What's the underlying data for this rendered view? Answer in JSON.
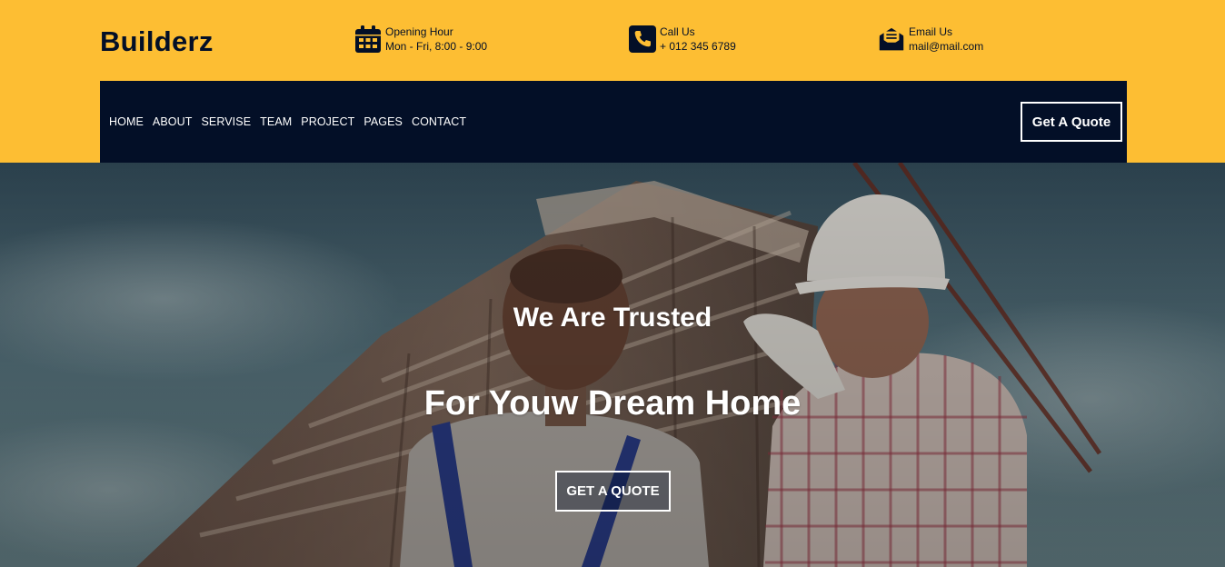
{
  "brand": {
    "name": "Builderz"
  },
  "header_info": {
    "hours": {
      "icon": "calendar-icon",
      "title": "Opening Hour",
      "value": "Mon - Fri, 8:00 - 9:00"
    },
    "call": {
      "icon": "phone-icon",
      "title": "Call Us",
      "value": "+ 012 345 6789"
    },
    "email": {
      "icon": "envelope-icon",
      "title": "Email Us",
      "value": "mail@mail.com"
    }
  },
  "nav": {
    "items": [
      "HOME",
      "ABOUT",
      "SERVISE",
      "TEAM",
      "PROJECT",
      "PAGES",
      "CONTACT"
    ],
    "quote_label": "Get A Quote"
  },
  "hero": {
    "subtitle": "We Are Trusted",
    "title": "For Youw Dream Home",
    "button_label": "GET A QUOTE"
  },
  "colors": {
    "accent": "#fdbe33",
    "dark": "#030f27",
    "text_light": "#ffffff"
  }
}
